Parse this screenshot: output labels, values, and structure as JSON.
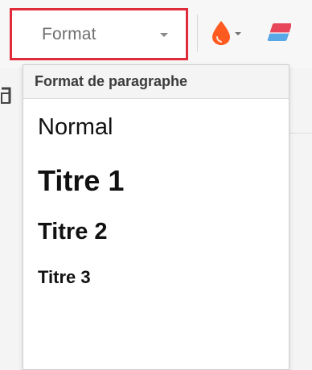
{
  "toolbar": {
    "format_dropdown": {
      "label": "Format",
      "caret_icon": "caret-down-icon",
      "highlight_color": "#e12a3a"
    },
    "color_button": {
      "icon": "drop-icon",
      "icon_color": "#ff5a1f"
    },
    "eraser_button": {
      "icon": "eraser-icon"
    }
  },
  "format_menu": {
    "header": "Format de paragraphe",
    "options": [
      {
        "label": "Normal",
        "style": "normal"
      },
      {
        "label": "Titre 1",
        "style": "h1"
      },
      {
        "label": "Titre 2",
        "style": "h2"
      },
      {
        "label": "Titre 3",
        "style": "h3"
      }
    ]
  }
}
